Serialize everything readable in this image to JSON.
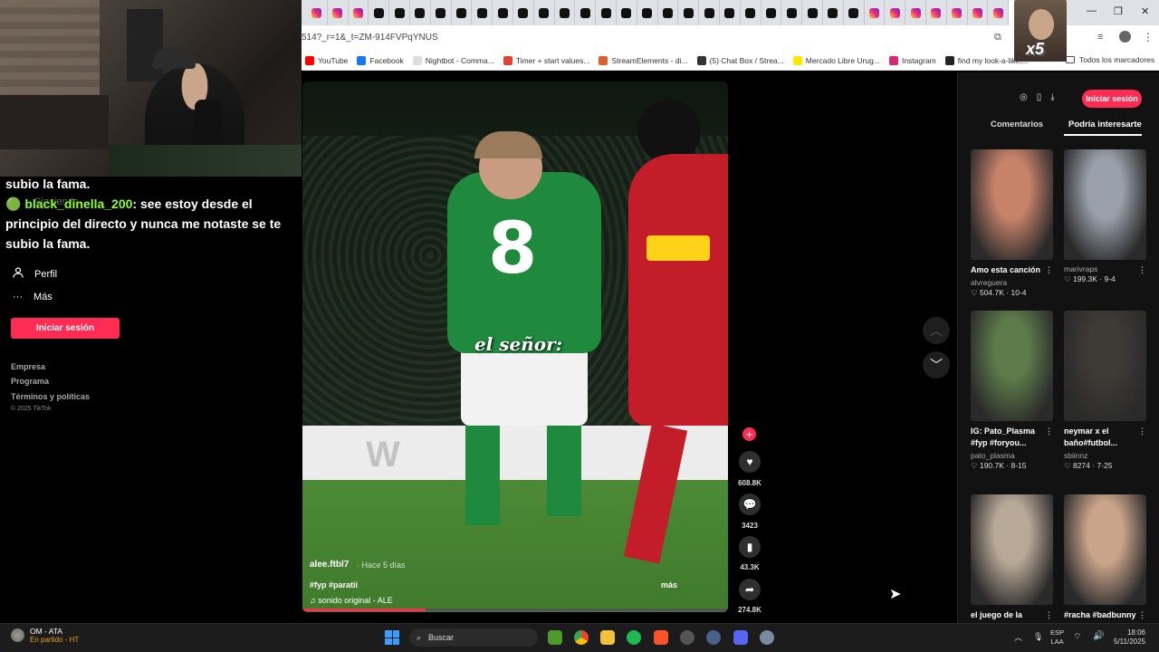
{
  "browser": {
    "url": "514?_r=1&_t=ZM-914FVPqYNUS",
    "bookmarks": [
      {
        "label": "YouTube",
        "color": "#ff0000"
      },
      {
        "label": "Facebook",
        "color": "#1877f2"
      },
      {
        "label": "Nightbot - Comma...",
        "color": "#dddddd"
      },
      {
        "label": "Timer + start values...",
        "color": "#e34234"
      },
      {
        "label": "StreamElements - di...",
        "color": "#e05d2d"
      },
      {
        "label": "(5) Chat Box / Strea...",
        "color": "#333333"
      },
      {
        "label": "Mercado Libre Urug...",
        "color": "#ffe600"
      },
      {
        "label": "Instagram",
        "color": "#d62976"
      },
      {
        "label": "find my look-a-like,...",
        "color": "#222222"
      }
    ],
    "all_bookmarks": "Todos los marcadores",
    "cam_badge": "x5"
  },
  "chat": {
    "line0": "subio la fama.",
    "user": "black_dinella_200",
    "message": ": see estoy desde el principio del directo y nunca me notaste se te subio la fama.",
    "ghost_following": "Siguiendo"
  },
  "leftnav": {
    "profile": "Perfil",
    "more": "Más",
    "login": "Iniciar sesión",
    "footer": [
      "Empresa",
      "Programa",
      "Términos y políticas"
    ],
    "copyright": "© 2025 TikTok"
  },
  "video": {
    "overlay_text": "el señor:",
    "board_text": "W",
    "author": "alee.ftbl7",
    "time": "· Hace 5 días",
    "tags": "#fyp #paratii",
    "sound": "♫  sonido original - ALE",
    "more": "más",
    "progress": 0.29
  },
  "actions": {
    "likes": "608.8K",
    "comments": "3423",
    "saves": "43.3K",
    "shares": "274.8K"
  },
  "right": {
    "login": "Iniciar sesión",
    "tab_comments": "Comentarios",
    "tab_suggest": "Podría interesarte",
    "cards": [
      {
        "title": "Amo esta canción",
        "author": "alvreguera",
        "stats": "♡ 504.7K · 10-4",
        "color": "#c7826a"
      },
      {
        "title": "",
        "author": "marivraps",
        "stats": "♡ 199.3K · 9-4",
        "color": "#9aa0aa"
      },
      {
        "title": "IG: Pato_Plasma #fyp #foryou...",
        "author": "pato_plasma",
        "stats": "♡ 190.7K · 8-15",
        "color": "#5d7a4a"
      },
      {
        "title": "neymar x el baño#futbol...",
        "author": "sbiinnz",
        "stats": "♡ 8274 · 7-25",
        "color": "#3e3a36"
      },
      {
        "title": "el juego de la lámpara y Aladin...",
        "author": "",
        "stats": "",
        "color": "#b8a898"
      },
      {
        "title": "#racha #badbunny #españa...",
        "author": "",
        "stats": "",
        "color": "#c9a48a"
      }
    ]
  },
  "taskbar": {
    "game_title": "OM - ATA",
    "game_status": "En partido - HT",
    "search": "Buscar",
    "lang1": "ESP",
    "lang2": "LAA",
    "time": "18:06",
    "date": "5/11/2025"
  }
}
